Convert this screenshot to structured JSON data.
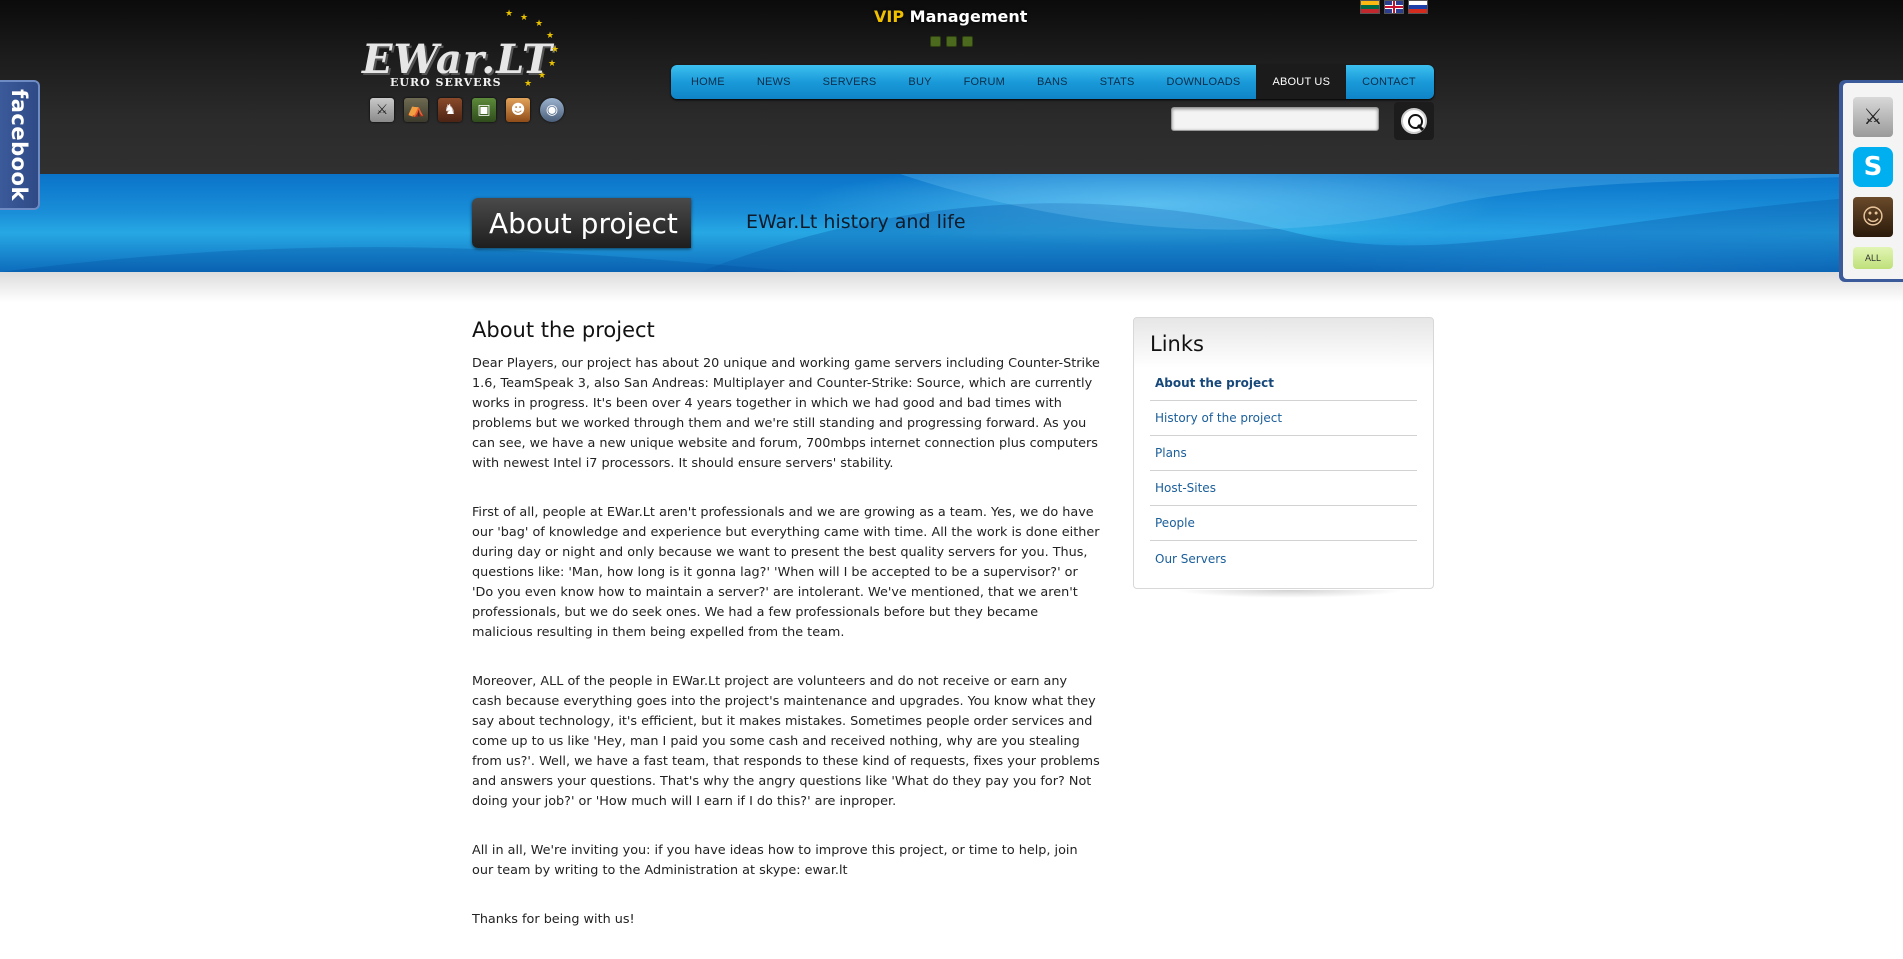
{
  "header": {
    "logo": {
      "text": "EWar.LT",
      "subtitle": "EURO SERVERS"
    },
    "game_icons": [
      "counter-strike-icon",
      "cs-source-icon",
      "san-andreas-icon",
      "minecraft-icon",
      "game-5-icon",
      "teamspeak-icon"
    ],
    "vip": {
      "prefix": "VIP",
      "title": "Management"
    },
    "flags": [
      "lithuania-flag-icon",
      "uk-flag-icon",
      "russia-flag-icon"
    ],
    "nav": [
      {
        "label": "HOME"
      },
      {
        "label": "NEWS"
      },
      {
        "label": "SERVERS"
      },
      {
        "label": "BUY"
      },
      {
        "label": "FORUM"
      },
      {
        "label": "BANS"
      },
      {
        "label": "STATS"
      },
      {
        "label": "DOWNLOADS"
      },
      {
        "label": "ABOUT US",
        "active": true
      },
      {
        "label": "CONTACT"
      }
    ],
    "search": {
      "value": "",
      "placeholder": ""
    }
  },
  "banner": {
    "title": "About project",
    "subtitle": "EWar.Lt history and life"
  },
  "facebook_tab": {
    "label": "facebook"
  },
  "side_widget": {
    "icons": [
      "counter-strike-icon",
      "skype-icon",
      "avatar-icon"
    ],
    "all_label": "ALL"
  },
  "article": {
    "title": "About the project",
    "paragraphs": [
      "Dear Players, our project has about 20 unique and working game servers including Counter-Strike 1.6, TeamSpeak 3, also San Andreas: Multiplayer and Counter-Strike: Source, which are currently works in progress. It's been over 4 years together in which we had good and bad times with problems but we worked through them and we're still standing and progressing forward. As you can see, we have a new unique website and forum, 700mbps internet connection plus computers with newest Intel i7 processors. It should ensure servers' stability.",
      " First of all, people at EWar.Lt aren't professionals and we are growing as a team. Yes, we do have our 'bag' of knowledge and experience but everything came with time. All the work is done either during day or night and only because we want to present the best quality servers for you. Thus, questions like: 'Man, how long is it gonna lag?' 'When will I be accepted to be a supervisor?' or 'Do you even know how to maintain a server?' are intolerant. We've mentioned, that we aren't professionals, but we do seek ones. We had a few professionals before but they became malicious resulting in them being expelled from the team.",
      "Moreover, ALL of the people in EWar.Lt project are volunteers and do not receive or earn any cash because everything goes into the project's maintenance and upgrades. You know what they say about technology, it's efficient, but it makes mistakes. Sometimes people order services and come up to us like 'Hey, man I paid you some cash and received nothing, why are you stealing from us?'. Well, we have a fast team, that responds to these kind of requests, fixes your problems and answers your questions. That's why the angry questions like 'What do they pay you for? Not doing your job?' or 'How much will I earn if I do this?' are inproper.",
      "All in all, We're inviting you: if you have ideas how to improve this project, or time to help, join our team by writing to the Administration at skype: ewar.lt",
      "Thanks for being with us!"
    ]
  },
  "links": {
    "title": "Links",
    "items": [
      {
        "label": "About the project",
        "active": true
      },
      {
        "label": "History of the project"
      },
      {
        "label": "Plans"
      },
      {
        "label": "Host-Sites"
      },
      {
        "label": "People"
      },
      {
        "label": "Our Servers"
      }
    ]
  },
  "colors": {
    "nav_blue": "#1a9ad9",
    "banner_blue": "#1a8fd8",
    "vip_gold": "#f0c000",
    "link_blue": "#1a5e9a",
    "facebook_blue": "#3b5a9a"
  }
}
